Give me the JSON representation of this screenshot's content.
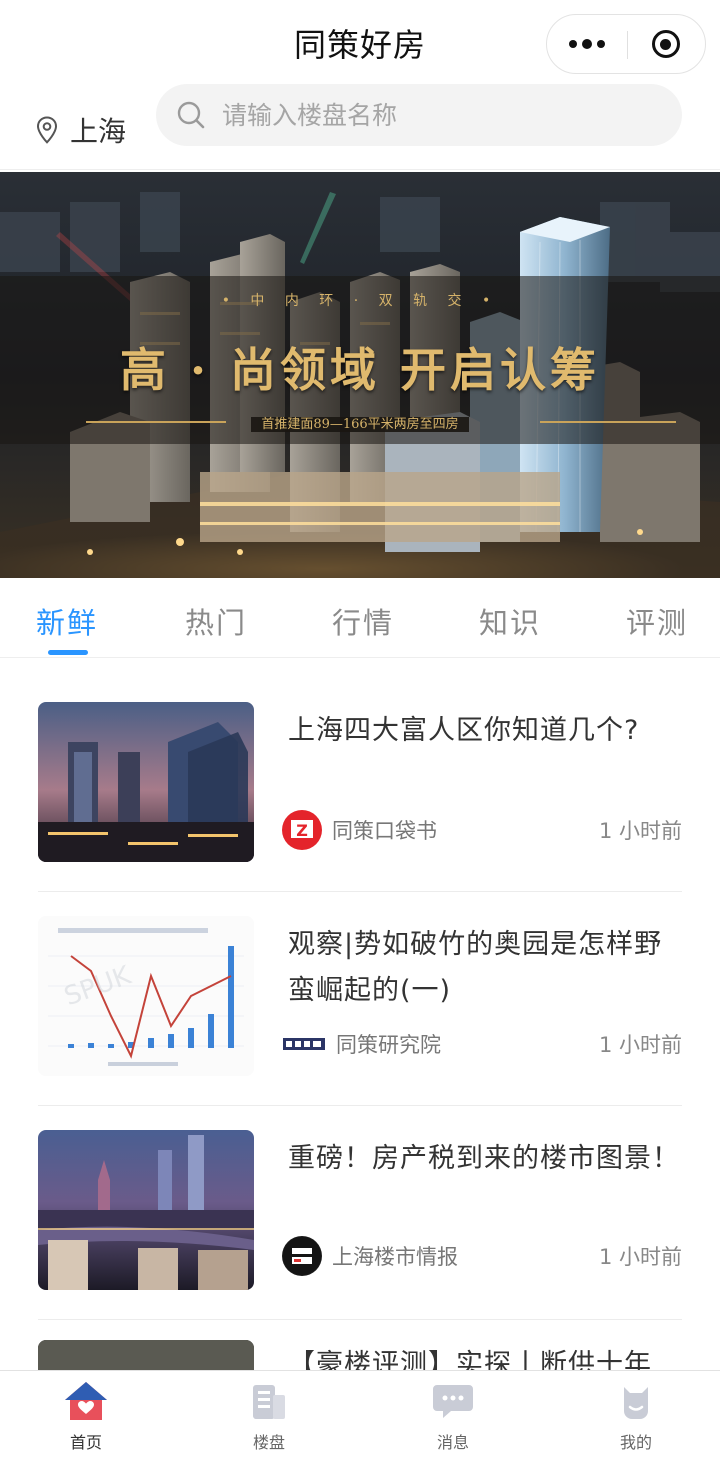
{
  "app": {
    "title": "同策好房"
  },
  "location": {
    "city": "上海"
  },
  "search": {
    "placeholder": "请输入楼盘名称"
  },
  "banner": {
    "small_text": "• 中 内 环 · 双 轨 交 •",
    "headline": "高 · 尚领域  开启认筹",
    "subline": "首推建面89—166平米两房至四房"
  },
  "tabs": [
    {
      "label": "新鲜",
      "active": true
    },
    {
      "label": "热门",
      "active": false
    },
    {
      "label": "行情",
      "active": false
    },
    {
      "label": "知识",
      "active": false
    },
    {
      "label": "评测",
      "active": false
    }
  ],
  "articles": [
    {
      "title": "上海四大富人区你知道几个?",
      "source": "同策口袋书",
      "time": "1 小时前",
      "avatar_icon": "pocket-book-logo-icon"
    },
    {
      "title": "观察|势如破竹的奥园是怎样野蛮崛起的(一)",
      "source": "同策研究院",
      "time": "1 小时前",
      "avatar_icon": "research-institute-logo-icon"
    },
    {
      "title": "重磅！房产税到来的楼市图景！",
      "source": "上海楼市情报",
      "time": "1 小时前",
      "avatar_icon": "shanghai-property-news-logo-icon"
    },
    {
      "title": "【豪楼评测】实探丨断供十年",
      "source": "",
      "time": ""
    }
  ],
  "bottom_nav": [
    {
      "label": "首页",
      "icon": "home-icon",
      "active": true
    },
    {
      "label": "楼盘",
      "icon": "buildings-icon",
      "active": false
    },
    {
      "label": "消息",
      "icon": "message-icon",
      "active": false
    },
    {
      "label": "我的",
      "icon": "profile-icon",
      "active": false
    }
  ],
  "colors": {
    "accent": "#2a95ff",
    "home_active": "#e8505b",
    "banner_gold": "#e0ba6e"
  }
}
